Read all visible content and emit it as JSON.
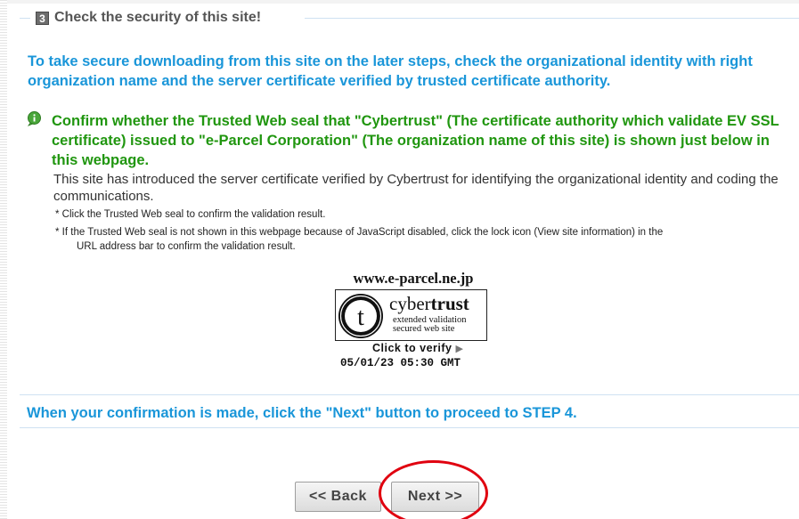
{
  "step": {
    "number": "3",
    "title": "Check the security of this site!"
  },
  "intro": "To take secure downloading from this site on the later steps, check the organizational identity with right organization name and the server certificate verified by trusted certificate authority.",
  "confirm": {
    "icon": "info-bubble-icon",
    "title": "Confirm whether the Trusted Web seal that \"Cybertrust\" (The certificate authority which validate EV SSL certificate) issued to \"e-Parcel Corporation\" (The organization name of this site) is shown just below in this webpage.",
    "body": "This site has introduced the server certificate verified by Cybertrust for identifying the organizational identity and coding the communications."
  },
  "notes": {
    "note1": "* Click the Trusted Web seal to confirm the validation result.",
    "note2_a": "* If the Trusted Web seal is not shown in this webpage because of JavaScript disabled, click the lock icon (View site information) in the",
    "note2_b": "URL address bar to confirm the validation result."
  },
  "seal": {
    "domain": "www.e-parcel.ne.jp",
    "brand_light": "cyber",
    "brand_bold": "trust",
    "line1": "extended validation",
    "line2": "secured web site",
    "verify_label": "Click to verify",
    "verify_arrow": "▶",
    "timestamp": "05/01/23 05:30 GMT"
  },
  "next_hint": "When your confirmation is made, click the \"Next\" button to proceed to STEP 4.",
  "buttons": {
    "back": "<< Back",
    "next": "Next >>"
  },
  "colors": {
    "heading_blue": "#1a96d9",
    "confirm_green": "#20960f",
    "highlight_red": "#e0000f"
  }
}
